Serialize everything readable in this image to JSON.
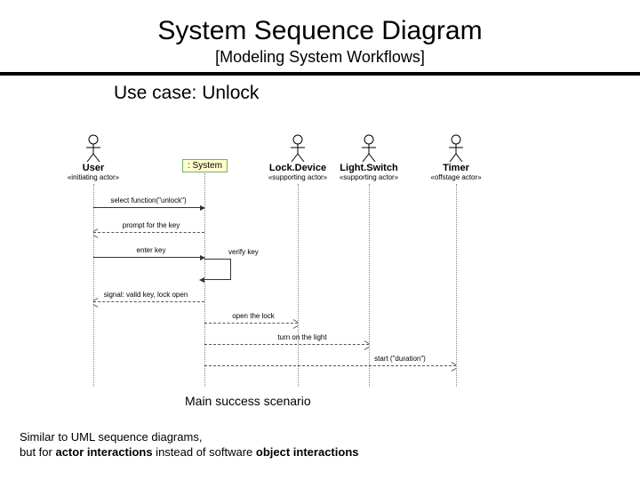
{
  "title": "System Sequence Diagram",
  "subtitle": "[Modeling System Workflows]",
  "usecase": "Use case: Unlock",
  "system_label": ": System",
  "actors": {
    "user": {
      "name": "User",
      "stereo": "«initiating actor»"
    },
    "lock": {
      "name": "Lock.Device",
      "stereo": "«supporting actor»"
    },
    "light": {
      "name": "Light.Switch",
      "stereo": "«supporting actor»"
    },
    "timer": {
      "name": "Timer",
      "stereo": "«offstage actor»"
    }
  },
  "messages": {
    "m1": "select function(\"unlock\")",
    "m2": "prompt for the key",
    "m3": "enter key",
    "m4": "verify key",
    "m5": "signal: valid key, lock open",
    "m6": "open the lock",
    "m7": "turn on the light",
    "m8": "start (\"duration\")"
  },
  "caption": "Main success scenario",
  "footnote_line1": "Similar to UML sequence diagrams,",
  "footnote_line2a": "but for ",
  "footnote_line2b": "actor interactions",
  "footnote_line2c": " instead of software ",
  "footnote_line2d": "object interactions"
}
